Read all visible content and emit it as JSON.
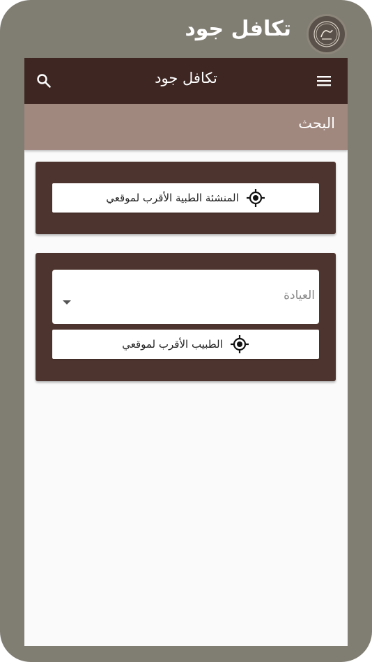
{
  "brand": {
    "title": "تكافل جود",
    "logo_icon": "seal-logo"
  },
  "appbar": {
    "title": "تكافل جود",
    "menu_icon": "hamburger-menu",
    "search_icon": "magnifier"
  },
  "subheader": {
    "title": "البحث"
  },
  "facility_card": {
    "nearest_facility_label": "المنشئة الطبية الأقرب لموقعي"
  },
  "doctor_card": {
    "clinic_select_label": "العيادة",
    "nearest_doctor_label": "الطبيب الأقرب لموقعي"
  },
  "colors": {
    "appbar": "#3e2723",
    "subheader": "#a1887f",
    "card": "#4e342e",
    "frame": "#807d73"
  }
}
